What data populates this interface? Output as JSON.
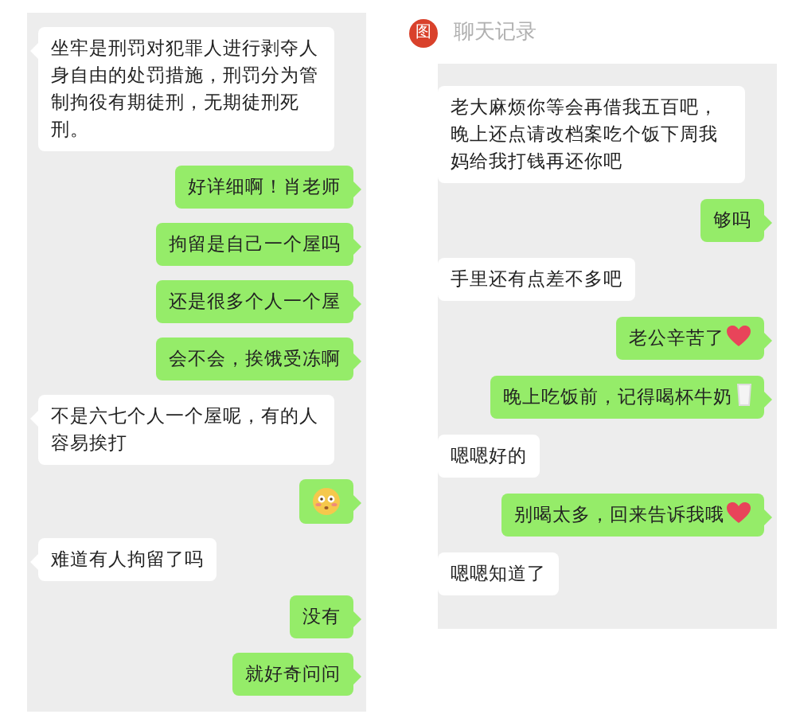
{
  "left_chat": {
    "messages": [
      {
        "kind": "received",
        "text": "坐牢是刑罚对犯罪人进行剥夺人身自由的处罚措施，刑罚分为管制拘役有期徒刑，无期徒刑死刑。"
      },
      {
        "kind": "sent",
        "text": "好详细啊！肖老师"
      },
      {
        "kind": "sent",
        "text": "拘留是自己一个屋吗"
      },
      {
        "kind": "sent",
        "text": "还是很多个人一个屋"
      },
      {
        "kind": "sent",
        "text": "会不会，挨饿受冻啊"
      },
      {
        "kind": "received",
        "text": "不是六七个人一个屋呢，有的人容易挨打"
      },
      {
        "kind": "sent"
      },
      {
        "kind": "received",
        "text": "难道有人拘留了吗"
      },
      {
        "kind": "sent",
        "text": "没有"
      },
      {
        "kind": "sent",
        "text": "就好奇问问"
      }
    ]
  },
  "right_chat": {
    "header": {
      "badge": "图",
      "title": "聊天记录"
    },
    "messages": [
      {
        "kind": "received",
        "text": "老大麻烦你等会再借我五百吧，晚上还点请改档案吃个饭下周我妈给我打钱再还你吧"
      },
      {
        "kind": "sent",
        "text": "够吗"
      },
      {
        "kind": "received",
        "text": "手里还有点差不多吧"
      },
      {
        "kind": "sent",
        "text": "老公辛苦了"
      },
      {
        "kind": "sent",
        "text": "晚上吃饭前，记得喝杯牛奶"
      },
      {
        "kind": "received",
        "text": "嗯嗯好的"
      },
      {
        "kind": "sent",
        "text": "别喝太多，回来告诉我哦"
      },
      {
        "kind": "received",
        "text": "嗯嗯知道了"
      }
    ]
  }
}
